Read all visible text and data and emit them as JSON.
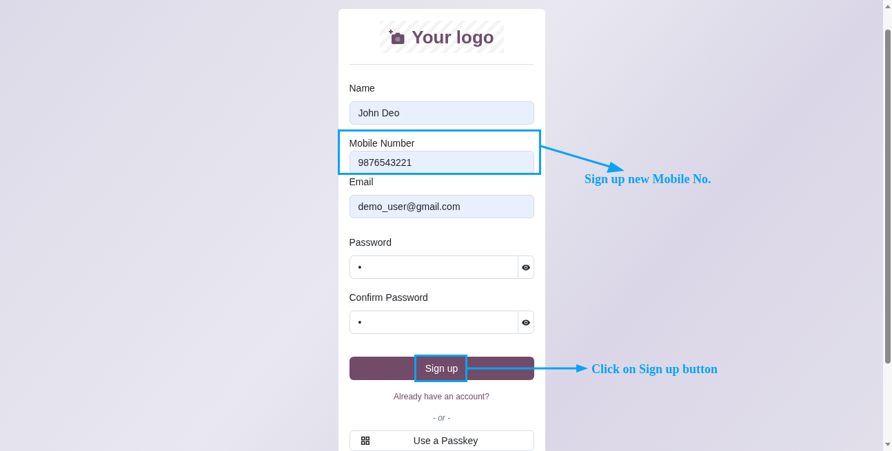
{
  "logo": {
    "text": "Your logo"
  },
  "fields": [
    {
      "label": "Name",
      "value": "John Deo",
      "autofilled": true,
      "kind": "text"
    },
    {
      "label": "Mobile Number",
      "value": "9876543221",
      "autofilled": true,
      "kind": "text"
    },
    {
      "label": "Email",
      "value": "demo_user@gmail.com",
      "autofilled": true,
      "kind": "text"
    },
    {
      "label": "Password",
      "value": "•",
      "autofilled": false,
      "kind": "password"
    },
    {
      "label": "Confirm Password",
      "value": "•",
      "autofilled": false,
      "kind": "password"
    }
  ],
  "submit_button": {
    "label": "Sign up"
  },
  "login_link": "Already have an account?",
  "separator": "- or -",
  "passkey_button": {
    "label": "Use a Passkey"
  },
  "callouts": [
    {
      "text": "Sign up new Mobile No."
    },
    {
      "text": "Click on Sign up button"
    }
  ]
}
